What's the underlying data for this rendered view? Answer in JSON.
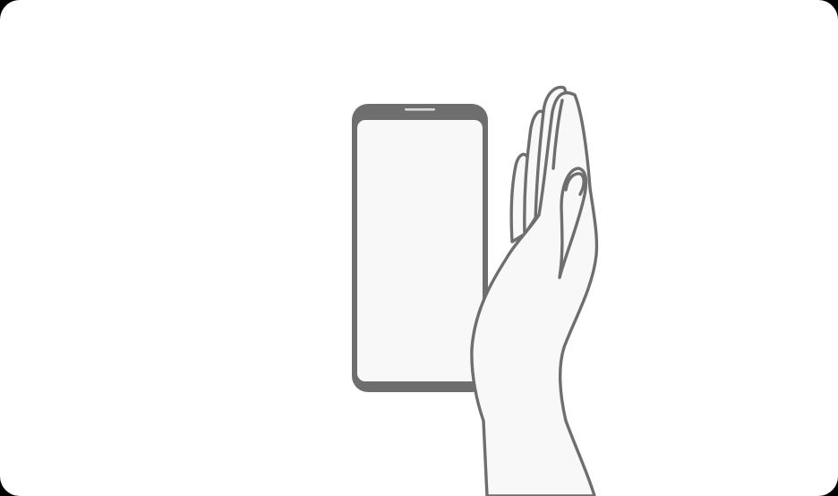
{
  "illustration": {
    "icons": [
      "smartphone-icon",
      "palm-swipe-hand-icon"
    ],
    "colors": {
      "background": "#ffffff",
      "outline": "#6e6e6e",
      "fill": "#f8f8f8",
      "phone_body": "#6e6e6e",
      "phone_screen": "#f8f8f8",
      "speaker": "#d8d8d8"
    }
  }
}
